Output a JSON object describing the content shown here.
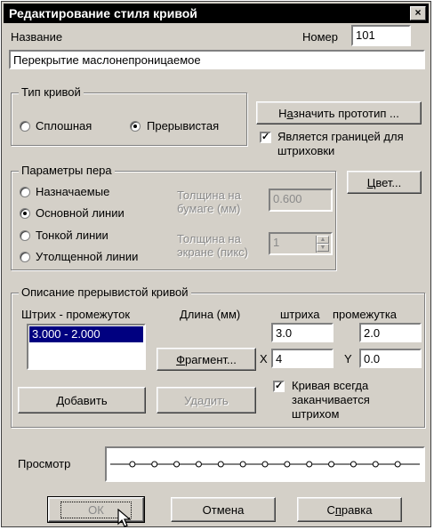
{
  "window": {
    "title": "Редактирование стиля кривой",
    "close_glyph": "×"
  },
  "name_label": "Название",
  "number_label": "Номер",
  "number_value": "101",
  "name_value": "Перекрытие маслонепроницаемое",
  "curve_type": {
    "title": "Тип кривой",
    "solid": "Сплошная",
    "dashed": "Прерывистая",
    "selected": "dashed"
  },
  "assign_prototype": {
    "prefix": "Н",
    "mnemonic": "а",
    "rest": "значить прототип ..."
  },
  "hatch_border": {
    "label_line1": "Является границей для",
    "label_line2": "штриховки",
    "checked": true
  },
  "pen": {
    "title": "Параметры пера",
    "options": [
      "Назначаемые",
      "Основной линии",
      "Тонкой линии",
      "Утолщенной линии"
    ],
    "selected_index": 1,
    "paper_label_1": "Толщина на",
    "paper_label_2": "бумаге (мм)",
    "paper_value": "0.600",
    "screen_label_1": "Толщина на",
    "screen_label_2": "экране (пикс)",
    "screen_value": "1"
  },
  "color_button": {
    "mnemonic": "Ц",
    "rest": "вет..."
  },
  "dash_desc": {
    "title": "Описание прерывистой кривой",
    "list_header": "Штрих - промежуток",
    "length_header": "Длина (мм)",
    "dash_header": "штриха",
    "gap_header": "промежутка",
    "list_items": [
      "3.000 - 2.000"
    ],
    "dash_value": "3.0",
    "gap_value": "2.0",
    "x_label": "X",
    "x_value": "4",
    "y_label": "Y",
    "y_value": "0.0",
    "fragment_button": {
      "mnemonic": "Ф",
      "rest": "рагмент..."
    },
    "add_button": {
      "mnemonic": "Д",
      "rest": "обавить"
    },
    "delete_button": {
      "pre": "Уда",
      "mnemonic": "л",
      "rest": "ить"
    },
    "ends_with_dash": {
      "line1": "Кривая всегда",
      "line2": "заканчивается",
      "line3": "штрихом",
      "checked": true
    }
  },
  "preview_label": "Просмотр",
  "buttons": {
    "ok": "ОК",
    "cancel": "Отмена",
    "help_pre": "С",
    "help_mnemonic": "п",
    "help_rest": "равка"
  },
  "icons": {
    "radio": "radio-icon",
    "check": "checkmark-icon",
    "cursor": "mouse-pointer-icon"
  }
}
